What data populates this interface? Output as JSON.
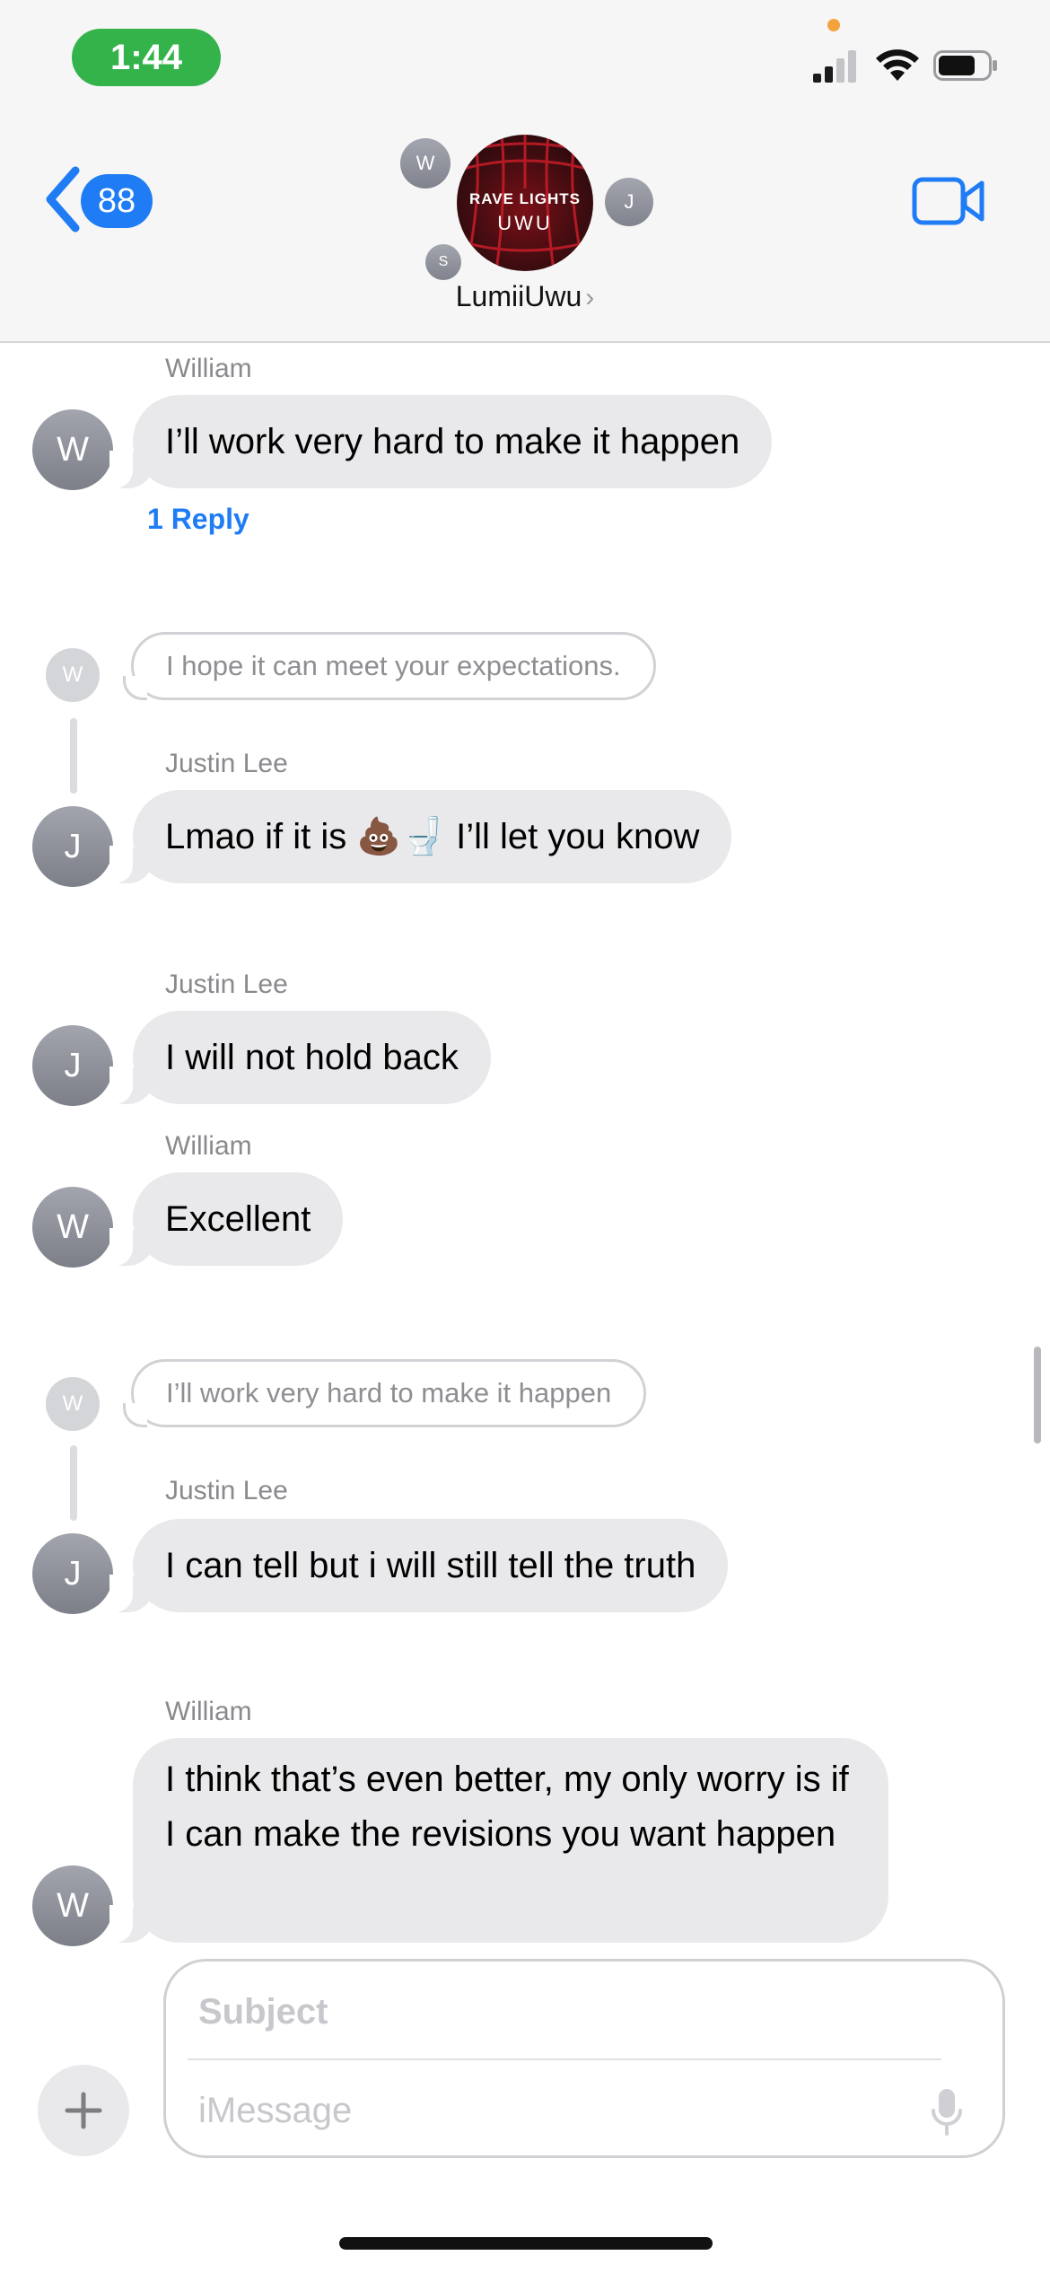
{
  "status_bar": {
    "time": "1:44"
  },
  "nav": {
    "back_count": "88",
    "group_name": "LumiiUwu",
    "group_photo_text_top": "RAVE LIGHTS",
    "group_photo_text_bottom": "UWU",
    "members": [
      "W",
      "J",
      "S"
    ]
  },
  "messages": [
    {
      "sender": "William",
      "initial": "W",
      "text": "I’ll work very hard to make it happen",
      "reply_label": "1 Reply"
    },
    {
      "quote_initial": "W",
      "quote_text": "I hope it can meet your expectations.",
      "sender": "Justin Lee",
      "initial": "J",
      "text": "Lmao if it is 💩🚽 I’ll let you know"
    },
    {
      "sender": "Justin Lee",
      "initial": "J",
      "text": "I will not hold back"
    },
    {
      "sender": "William",
      "initial": "W",
      "text": "Excellent"
    },
    {
      "quote_initial": "W",
      "quote_text": "I’ll work very hard to make it happen",
      "sender": "Justin Lee",
      "initial": "J",
      "text": "I can tell but i will still tell the truth"
    },
    {
      "sender": "William",
      "initial": "W",
      "text": "I think that’s even better, my only worry is if I can make the revisions you want happen"
    }
  ],
  "composer": {
    "subject_placeholder": "Subject",
    "message_placeholder": "iMessage"
  },
  "colors": {
    "accent": "#1f7cf5",
    "time_pill": "#34b34b",
    "bubble": "#e9e9eb"
  }
}
